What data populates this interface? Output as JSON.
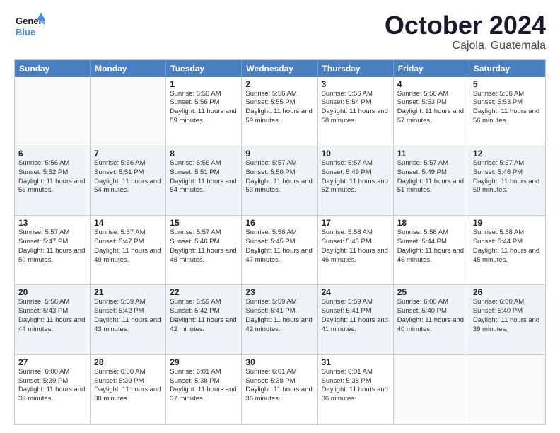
{
  "logo": {
    "line1": "General",
    "line2": "Blue"
  },
  "title": "October 2024",
  "subtitle": "Cajola, Guatemala",
  "days": [
    "Sunday",
    "Monday",
    "Tuesday",
    "Wednesday",
    "Thursday",
    "Friday",
    "Saturday"
  ],
  "weeks": [
    [
      {
        "day": "",
        "info": ""
      },
      {
        "day": "",
        "info": ""
      },
      {
        "day": "1",
        "info": "Sunrise: 5:56 AM\nSunset: 5:56 PM\nDaylight: 11 hours and 59 minutes."
      },
      {
        "day": "2",
        "info": "Sunrise: 5:56 AM\nSunset: 5:55 PM\nDaylight: 11 hours and 59 minutes."
      },
      {
        "day": "3",
        "info": "Sunrise: 5:56 AM\nSunset: 5:54 PM\nDaylight: 11 hours and 58 minutes."
      },
      {
        "day": "4",
        "info": "Sunrise: 5:56 AM\nSunset: 5:53 PM\nDaylight: 11 hours and 57 minutes."
      },
      {
        "day": "5",
        "info": "Sunrise: 5:56 AM\nSunset: 5:53 PM\nDaylight: 11 hours and 56 minutes."
      }
    ],
    [
      {
        "day": "6",
        "info": "Sunrise: 5:56 AM\nSunset: 5:52 PM\nDaylight: 11 hours and 55 minutes."
      },
      {
        "day": "7",
        "info": "Sunrise: 5:56 AM\nSunset: 5:51 PM\nDaylight: 11 hours and 54 minutes."
      },
      {
        "day": "8",
        "info": "Sunrise: 5:56 AM\nSunset: 5:51 PM\nDaylight: 11 hours and 54 minutes."
      },
      {
        "day": "9",
        "info": "Sunrise: 5:57 AM\nSunset: 5:50 PM\nDaylight: 11 hours and 53 minutes."
      },
      {
        "day": "10",
        "info": "Sunrise: 5:57 AM\nSunset: 5:49 PM\nDaylight: 11 hours and 52 minutes."
      },
      {
        "day": "11",
        "info": "Sunrise: 5:57 AM\nSunset: 5:49 PM\nDaylight: 11 hours and 51 minutes."
      },
      {
        "day": "12",
        "info": "Sunrise: 5:57 AM\nSunset: 5:48 PM\nDaylight: 11 hours and 50 minutes."
      }
    ],
    [
      {
        "day": "13",
        "info": "Sunrise: 5:57 AM\nSunset: 5:47 PM\nDaylight: 11 hours and 50 minutes."
      },
      {
        "day": "14",
        "info": "Sunrise: 5:57 AM\nSunset: 5:47 PM\nDaylight: 11 hours and 49 minutes."
      },
      {
        "day": "15",
        "info": "Sunrise: 5:57 AM\nSunset: 5:46 PM\nDaylight: 11 hours and 48 minutes."
      },
      {
        "day": "16",
        "info": "Sunrise: 5:58 AM\nSunset: 5:45 PM\nDaylight: 11 hours and 47 minutes."
      },
      {
        "day": "17",
        "info": "Sunrise: 5:58 AM\nSunset: 5:45 PM\nDaylight: 11 hours and 46 minutes."
      },
      {
        "day": "18",
        "info": "Sunrise: 5:58 AM\nSunset: 5:44 PM\nDaylight: 11 hours and 46 minutes."
      },
      {
        "day": "19",
        "info": "Sunrise: 5:58 AM\nSunset: 5:44 PM\nDaylight: 11 hours and 45 minutes."
      }
    ],
    [
      {
        "day": "20",
        "info": "Sunrise: 5:58 AM\nSunset: 5:43 PM\nDaylight: 11 hours and 44 minutes."
      },
      {
        "day": "21",
        "info": "Sunrise: 5:59 AM\nSunset: 5:42 PM\nDaylight: 11 hours and 43 minutes."
      },
      {
        "day": "22",
        "info": "Sunrise: 5:59 AM\nSunset: 5:42 PM\nDaylight: 11 hours and 42 minutes."
      },
      {
        "day": "23",
        "info": "Sunrise: 5:59 AM\nSunset: 5:41 PM\nDaylight: 11 hours and 42 minutes."
      },
      {
        "day": "24",
        "info": "Sunrise: 5:59 AM\nSunset: 5:41 PM\nDaylight: 11 hours and 41 minutes."
      },
      {
        "day": "25",
        "info": "Sunrise: 6:00 AM\nSunset: 5:40 PM\nDaylight: 11 hours and 40 minutes."
      },
      {
        "day": "26",
        "info": "Sunrise: 6:00 AM\nSunset: 5:40 PM\nDaylight: 11 hours and 39 minutes."
      }
    ],
    [
      {
        "day": "27",
        "info": "Sunrise: 6:00 AM\nSunset: 5:39 PM\nDaylight: 11 hours and 39 minutes."
      },
      {
        "day": "28",
        "info": "Sunrise: 6:00 AM\nSunset: 5:39 PM\nDaylight: 11 hours and 38 minutes."
      },
      {
        "day": "29",
        "info": "Sunrise: 6:01 AM\nSunset: 5:38 PM\nDaylight: 11 hours and 37 minutes."
      },
      {
        "day": "30",
        "info": "Sunrise: 6:01 AM\nSunset: 5:38 PM\nDaylight: 11 hours and 36 minutes."
      },
      {
        "day": "31",
        "info": "Sunrise: 6:01 AM\nSunset: 5:38 PM\nDaylight: 11 hours and 36 minutes."
      },
      {
        "day": "",
        "info": ""
      },
      {
        "day": "",
        "info": ""
      }
    ]
  ]
}
